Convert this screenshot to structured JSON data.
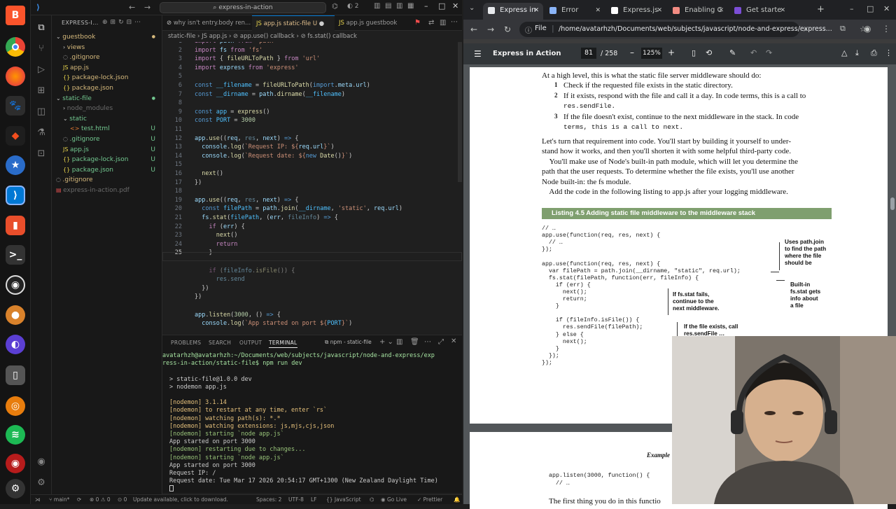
{
  "vscode": {
    "search": "express-in-action",
    "explorer_label": "EXPRESS-I...",
    "tree": [
      {
        "label": "guestbook",
        "kind": "folder-open",
        "color": "#d7ba7d",
        "indent": 0
      },
      {
        "label": "views",
        "kind": "folder",
        "color": "#d7ba7d",
        "indent": 1
      },
      {
        "label": ".gitignore",
        "kind": "file",
        "color": "#d7ba7d",
        "indent": 1
      },
      {
        "label": "app.js",
        "kind": "js",
        "color": "#d7ba7d",
        "indent": 1
      },
      {
        "label": "package-lock.json",
        "kind": "json",
        "color": "#d7ba7d",
        "indent": 1
      },
      {
        "label": "package.json",
        "kind": "json",
        "color": "#d7ba7d",
        "indent": 1
      },
      {
        "label": "static-file",
        "kind": "folder-open",
        "color": "#73c991",
        "indent": 0
      },
      {
        "label": "node_modules",
        "kind": "folder",
        "color": "#6b6b6b",
        "indent": 1
      },
      {
        "label": "static",
        "kind": "folder-open",
        "color": "#73c991",
        "indent": 1
      },
      {
        "label": "test.html",
        "kind": "html",
        "color": "#73c991",
        "indent": 2,
        "badge": "U"
      },
      {
        "label": ".gitignore",
        "kind": "file",
        "color": "#73c991",
        "indent": 1,
        "badge": "U"
      },
      {
        "label": "app.js",
        "kind": "js",
        "color": "#73c991",
        "indent": 1,
        "badge": "U"
      },
      {
        "label": "package-lock.json",
        "kind": "json",
        "color": "#73c991",
        "indent": 1,
        "badge": "U"
      },
      {
        "label": "package.json",
        "kind": "json",
        "color": "#73c991",
        "indent": 1,
        "badge": "U"
      },
      {
        "label": ".gitignore",
        "kind": "file",
        "color": "#d7ba7d",
        "indent": 0
      },
      {
        "label": "express-in-action.pdf",
        "kind": "pdf",
        "color": "#6b6b6b",
        "indent": 0
      }
    ],
    "tabs": [
      {
        "label": "why isn't entry.body ren...",
        "active": false
      },
      {
        "label": "app.js static-file U",
        "active": true
      },
      {
        "label": "app.js guestbook",
        "active": false
      }
    ],
    "breadcrumb": "static-file › JS app.js › ⊘ app.use() callback › ⊘ fs.stat() callback",
    "lines": [
      {
        "n": "1",
        "html": "<span class='kw'>import</span> <span class='var'>path</span> <span class='kw'>from</span> <span class='str'>'path'</span>"
      },
      {
        "n": "2",
        "html": "<span class='kw'>import</span> <span class='var'>fs</span> <span class='kw'>from</span> <span class='str'>'fs'</span>"
      },
      {
        "n": "3",
        "html": "<span class='kw'>import</span> { <span class='fn'>fileURLToPath</span> } <span class='kw'>from</span> <span class='str'>'url'</span>"
      },
      {
        "n": "4",
        "html": "<span class='kw'>import</span> <span class='var'>express</span> <span class='kw'>from</span> <span class='str'>'express'</span>"
      },
      {
        "n": "5",
        "html": ""
      },
      {
        "n": "6",
        "html": "<span class='kb'>const</span> <span class='cn'>__filename</span> = <span class='fn'>fileURLToPath</span>(<span class='kb'>import</span>.<span class='var'>meta</span>.<span class='var'>url</span>)"
      },
      {
        "n": "7",
        "html": "<span class='kb'>const</span> <span class='cn'>__dirname</span> = <span class='var'>path</span>.<span class='fn'>dirname</span>(<span class='cn'>__filename</span>)"
      },
      {
        "n": "8",
        "html": ""
      },
      {
        "n": "9",
        "html": "<span class='kb'>const</span> <span class='cn'>app</span> = <span class='fn'>express</span>()"
      },
      {
        "n": "10",
        "html": "<span class='kb'>const</span> <span class='cn'>PORT</span> = <span class='num'>3000</span>"
      },
      {
        "n": "11",
        "html": ""
      },
      {
        "n": "12",
        "html": "<span class='var'>app</span>.<span class='fn'>use</span>((<span class='var'>req</span>, <span class='var dim'>res</span>, <span class='var'>next</span>) <span class='kb'>=&gt;</span> {"
      },
      {
        "n": "13",
        "html": "  <span class='var'>console</span>.<span class='fn'>log</span>(<span class='str'>`Request IP: ${</span><span class='var'>req</span>.<span class='var'>url</span><span class='str'>}`</span>)"
      },
      {
        "n": "14",
        "html": "  <span class='var'>console</span>.<span class='fn'>log</span>(<span class='str'>`Request date: ${</span><span class='kb'>new</span> <span class='fn'>Date</span>()<span class='str'>}`</span>)"
      },
      {
        "n": "15",
        "html": ""
      },
      {
        "n": "16",
        "html": "  <span class='fn'>next</span>()"
      },
      {
        "n": "17",
        "html": "})"
      },
      {
        "n": "18",
        "html": ""
      },
      {
        "n": "19",
        "html": "<span class='var'>app</span>.<span class='fn'>use</span>((<span class='var'>req</span>, <span class='var dim'>res</span>, <span class='var'>next</span>) <span class='kb'>=&gt;</span> {"
      },
      {
        "n": "20",
        "html": "  <span class='kb'>const</span> <span class='cn'>filePath</span> = <span class='var'>path</span>.<span class='fn'>join</span>(<span class='cn'>__dirname</span>, <span class='str'>'static'</span>, <span class='var'>req</span>.<span class='var'>url</span>)"
      },
      {
        "n": "21",
        "html": "  <span class='var'>fs</span>.<span class='fn'>stat</span>(<span class='cn'>filePath</span>, (<span class='var'>err</span>, <span class='var dim'>fileInfo</span>) <span class='kb'>=&gt;</span> {"
      },
      {
        "n": "22",
        "html": "    <span class='kw'>if</span> (<span class='var'>err</span>) {"
      },
      {
        "n": "23",
        "html": "      <span class='fn'>next</span>()"
      },
      {
        "n": "24",
        "html": "      <span class='kw'>return</span>"
      },
      {
        "n": "25",
        "html": "    }"
      },
      {
        "n": "",
        "html": ""
      },
      {
        "n": "",
        "html": "<span class='dim'>    <span class='kw'>if</span> (<span class='var'>fileInfo</span>.<span class='fn'>isFile</span>()) {</span>"
      },
      {
        "n": "",
        "html": "<span class='dim'>      <span class='var'>res</span>.<span class='var'>send</span></span>"
      },
      {
        "n": "",
        "html": "  })"
      },
      {
        "n": "",
        "html": "})"
      },
      {
        "n": "",
        "html": ""
      },
      {
        "n": "",
        "html": "<span class='var'>app</span>.<span class='fn'>listen</span>(<span class='num'>3000</span>, () <span class='kb'>=&gt;</span> {"
      },
      {
        "n": "",
        "html": "  <span class='var'>console</span>.<span class='fn'>log</span>(<span class='str'>`App started on port ${</span><span class='cn'>PORT</span><span class='str'>}`</span>)"
      }
    ],
    "panel_tabs": [
      "PROBLEMS",
      "SEARCH",
      "OUTPUT",
      "TERMINAL"
    ],
    "terminal_name": "npm - static-file",
    "terminal_lines": [
      {
        "text": "avatarhzh@avatarhzh:~/Documents/web/subjects/javascript/node-and-express/exp",
        "color": "#cccccc"
      },
      {
        "text": "ress-in-action/static-file$ npm run dev",
        "color": "#cccccc"
      },
      {
        "text": "",
        "color": "#cccccc"
      },
      {
        "text": "> static-file@1.0.0 dev",
        "color": "#cccccc"
      },
      {
        "text": "> nodemon app.js",
        "color": "#cccccc"
      },
      {
        "text": "",
        "color": "#cccccc"
      },
      {
        "text": "[nodemon] 3.1.14",
        "color": "#e5c07b"
      },
      {
        "text": "[nodemon] to restart at any time, enter `rs`",
        "color": "#e5c07b"
      },
      {
        "text": "[nodemon] watching path(s): *.*",
        "color": "#e5c07b"
      },
      {
        "text": "[nodemon] watching extensions: js,mjs,cjs,json",
        "color": "#e5c07b"
      },
      {
        "text": "[nodemon] starting `node app.js`",
        "color": "#98c379"
      },
      {
        "text": "App started on port 3000",
        "color": "#cccccc"
      },
      {
        "text": "[nodemon] restarting due to changes...",
        "color": "#98c379"
      },
      {
        "text": "[nodemon] starting `node app.js`",
        "color": "#98c379"
      },
      {
        "text": "App started on port 3000",
        "color": "#cccccc"
      },
      {
        "text": "Request IP: /",
        "color": "#cccccc"
      },
      {
        "text": "Request date: Tue Mar 17 2026 20:54:17 GMT+1300 (New Zealand Daylight Time)",
        "color": "#cccccc"
      }
    ],
    "status": {
      "branch": "main*",
      "errors": "⊗ 0 ⚠ 0",
      "ports": "0",
      "update": "Update available, click to download.",
      "spaces": "Spaces: 2",
      "encoding": "UTF-8",
      "eol": "LF",
      "lang": "{} JavaScript",
      "golive": "Go Live",
      "prettier": "✓ Prettier"
    }
  },
  "chrome": {
    "tabs": [
      {
        "label": "Express in",
        "active": true,
        "icon": "#e8eaed"
      },
      {
        "label": "Error",
        "active": false,
        "icon": "#8ab4f8"
      },
      {
        "label": "Express.js",
        "active": false,
        "icon": "#ffffff"
      },
      {
        "label": "Enabling C",
        "active": false,
        "icon": "#f28b82"
      },
      {
        "label": "Get starte",
        "active": false,
        "icon": "#7b4ed6"
      }
    ],
    "address_scheme": "File",
    "address": "/home/avatarhzh/Documents/web/subjects/javascript/node-and-express/express...",
    "pdf_title": "Express in Action",
    "page_current": "81",
    "page_total": "/ 258",
    "zoom": "125%"
  },
  "pdf": {
    "intro": "At a high level, this is what the static file server middleware should do:",
    "steps": [
      {
        "num": "1",
        "text": "Check if the requested file exists in the static directory."
      },
      {
        "num": "2",
        "text": "If it exists, respond with the file and call it a day. In code terms, this is a call to"
      },
      {
        "num": "",
        "text": "res.sendFile."
      },
      {
        "num": "3",
        "text": "If the file doesn't exist, continue to the next middleware in the stack. In code"
      },
      {
        "num": "",
        "text": "terms, this is a call to next."
      }
    ],
    "para": [
      "Let's turn that requirement into code. You'll start by building it yourself to under-",
      "stand how it works, and then you'll shorten it with some helpful third-party code.",
      "    You'll make use of Node's built-in path module, which will let you determine the",
      "path that the user requests. To determine whether the file exists, you'll use another",
      "Node built-in: the fs module.",
      "    Add the code in the following listing to app.js after your logging middleware."
    ],
    "listing_title": "Listing 4.5   Adding static file middleware to the middleware stack",
    "listing_code": [
      "// …",
      "app.use(function(req, res, next) {",
      "  // …",
      "});",
      "",
      "app.use(function(req, res, next) {",
      "  var filePath = path.join(__dirname, \"static\", req.url);",
      "  fs.stat(filePath, function(err, fileInfo) {",
      "    if (err) {",
      "      next();",
      "      return;",
      "    }",
      "",
      "    if (fileInfo.isFile()) {",
      "      res.sendFile(filePath);",
      "    } else {",
      "      next();",
      "    }",
      "  });",
      "});"
    ],
    "annotations": {
      "a1": "Uses path.join\nto find the path\nwhere the file\nshould be",
      "a2": "Built-in\nfs.stat gets\ninfo about\na file",
      "a3": "If fs.stat fails,\ncontinue to the\nnext middleware.",
      "a4": "If the file exists, call\nres.sendFile …"
    },
    "page2_heading": "Example",
    "page2_code": [
      "app.listen(3000, function() {",
      "  // …"
    ],
    "page2_text": "The first thing you do in this functio"
  },
  "webcam": {
    "label": "webcam overlay"
  }
}
